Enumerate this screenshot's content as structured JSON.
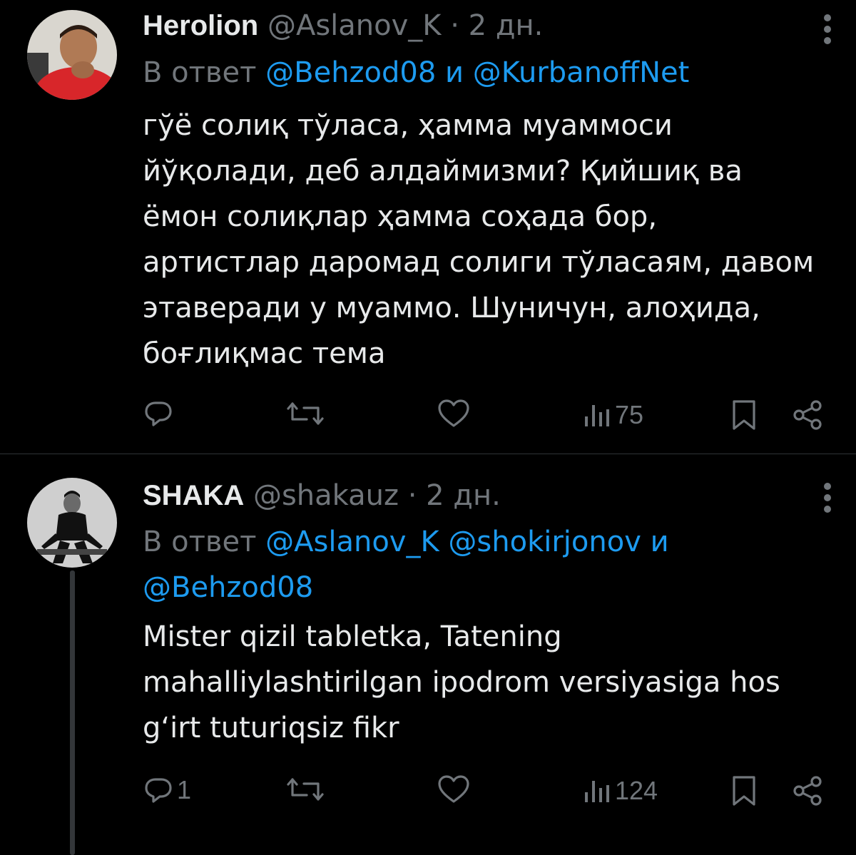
{
  "tweets": [
    {
      "name": "Herolion",
      "handle": "@Aslanov_K",
      "separator": "·",
      "time": "2 дн.",
      "reply_prefix": "В ответ",
      "reply_mentions": [
        "@Behzod08",
        "@KurbanoffNet"
      ],
      "reply_join": "и",
      "body": "гўё солиқ тўласа, ҳамма муаммоси\nйўқолади, деб алдаймизми? Қийшиқ ва\nёмон солиқлар ҳамма соҳада бор,\nартистлар даромад солиги тўласаям, давом\nэтаверади у муаммо. Шуничун, алоҳида,\nбоғлиқмас тема",
      "reply_count": "",
      "views": "75"
    },
    {
      "name": "SHAKA",
      "handle": "@shakauz",
      "separator": "·",
      "time": "2 дн.",
      "reply_prefix": "В ответ",
      "reply_mentions": [
        "@Aslanov_K",
        "@shokirjonov",
        "@Behzod08"
      ],
      "reply_join": "и",
      "body": "Mister qizil tabletka, Tatening\nmahalliylashtirilgan ipodrom versiyasiga hos\ng‘irt tuturiqsiz fikr",
      "reply_count": "1",
      "views": "124"
    }
  ],
  "colors": {
    "background": "#000000",
    "text": "#e7e9ea",
    "muted": "#71767b",
    "link": "#1d9bf0"
  },
  "icons": [
    "reply-icon",
    "retweet-icon",
    "like-icon",
    "views-icon",
    "bookmark-icon",
    "share-icon",
    "more-icon"
  ]
}
